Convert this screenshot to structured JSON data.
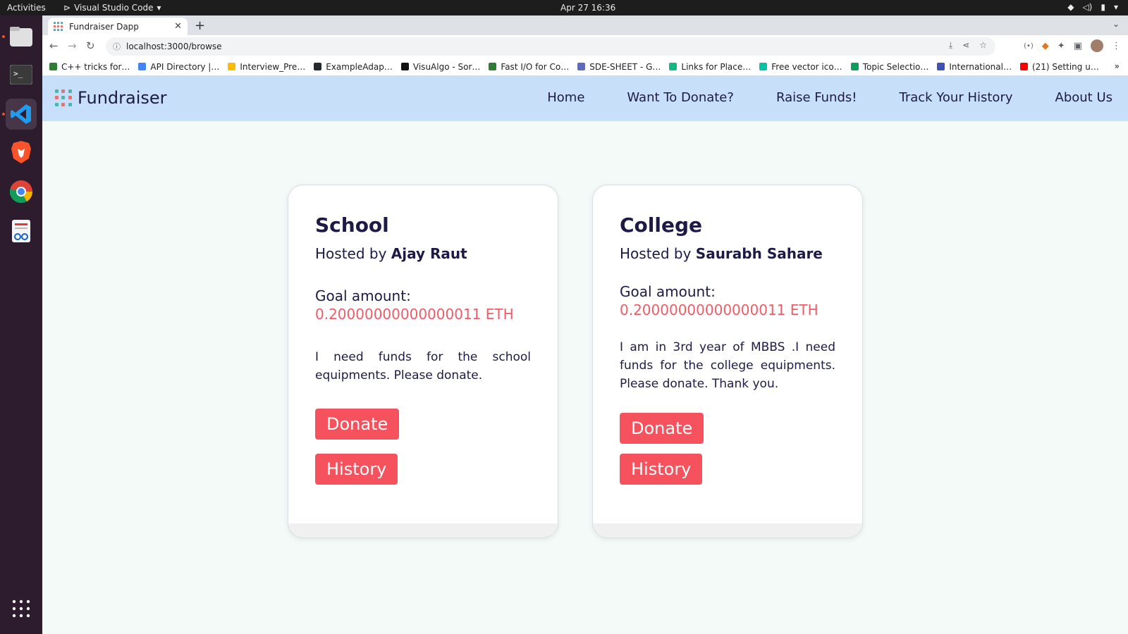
{
  "system": {
    "activities": "Activities",
    "app_name": "Visual Studio Code",
    "clock": "Apr 27  16:36"
  },
  "browser": {
    "tab_title": "Fundraiser Dapp",
    "url": "localhost:3000/browse",
    "bookmarks": [
      {
        "label": "C++ tricks for…",
        "color": "#2e7d32"
      },
      {
        "label": "API Directory |…",
        "color": "#4285f4"
      },
      {
        "label": "Interview_Pre…",
        "color": "#fbbc04"
      },
      {
        "label": "ExampleAdap…",
        "color": "#24292e"
      },
      {
        "label": "VisuAlgo - Sor…",
        "color": "#111111"
      },
      {
        "label": "Fast I/O for Co…",
        "color": "#2e7d32"
      },
      {
        "label": "SDE-SHEET - G…",
        "color": "#5c6bc0"
      },
      {
        "label": "Links for Place…",
        "color": "#10b981"
      },
      {
        "label": "Free vector ico…",
        "color": "#00c4a7"
      },
      {
        "label": "Topic Selectio…",
        "color": "#0f9d58"
      },
      {
        "label": "International…",
        "color": "#3f51b5"
      },
      {
        "label": "(21) Setting u…",
        "color": "#ff0000"
      }
    ]
  },
  "site": {
    "brand": "Fundraiser",
    "nav": [
      "Home",
      "Want To Donate?",
      "Raise Funds!",
      "Track Your History",
      "About Us"
    ]
  },
  "cards": [
    {
      "title": "School",
      "hosted_prefix": "Hosted by",
      "host": "Ajay Raut",
      "goal_label": "Goal amount:",
      "goal_value": "0.20000000000000011 ETH",
      "description": "I need funds for the school equipments. Please donate.",
      "donate_label": "Donate",
      "history_label": "History"
    },
    {
      "title": "College",
      "hosted_prefix": "Hosted by",
      "host": "Saurabh Sahare",
      "goal_label": "Goal amount:",
      "goal_value": "0.20000000000000011 ETH",
      "description": "I am in 3rd year of MBBS .I need funds for the college equipments. Please donate. Thank you.",
      "donate_label": "Donate",
      "history_label": "History"
    }
  ],
  "colors": {
    "navbar_bg": "#c7dff8",
    "page_bg": "#f4faf8",
    "button_bg": "#f5525e",
    "goal_text": "#ef5b66",
    "heading_text": "#1d1b46"
  }
}
